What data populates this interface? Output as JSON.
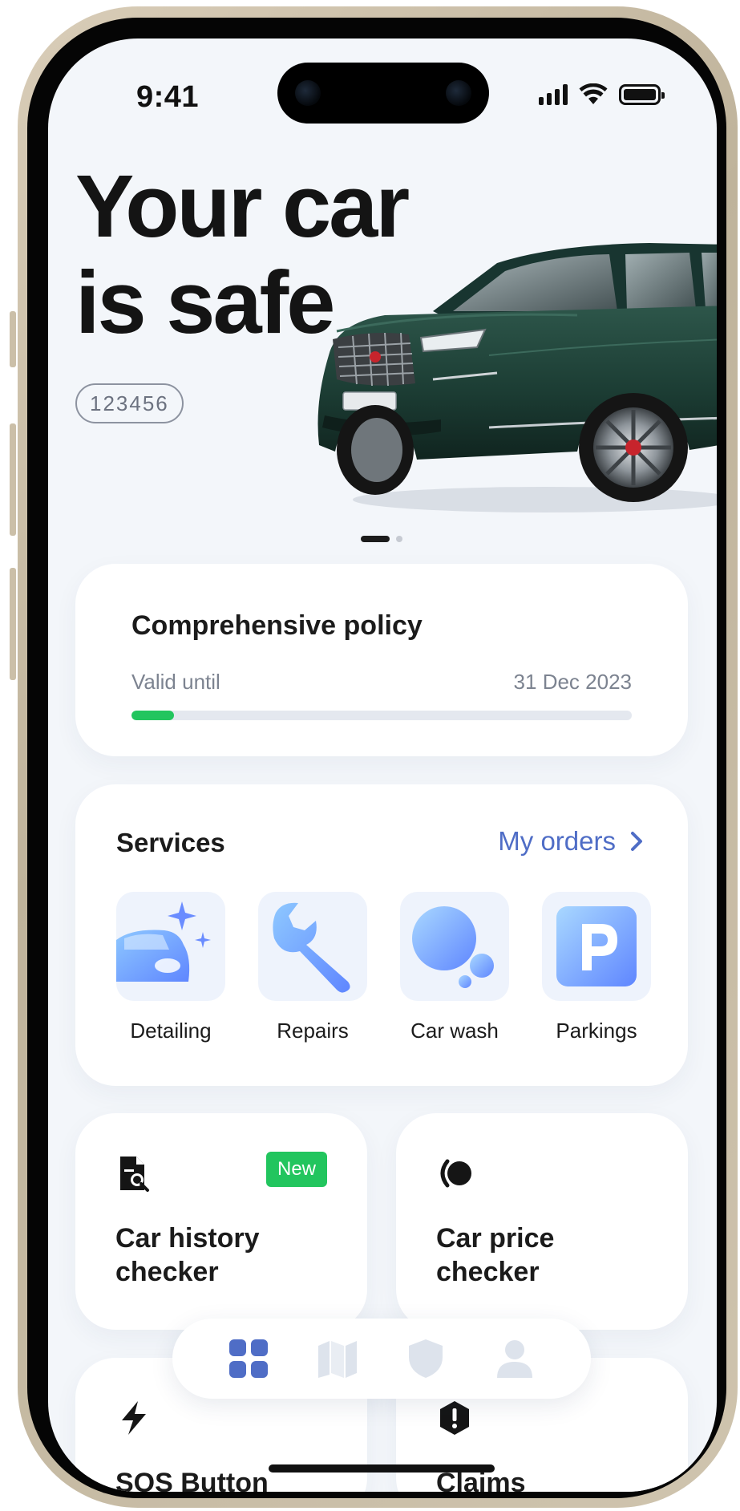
{
  "status_bar": {
    "time": "9:41"
  },
  "hero": {
    "title_line1": "Your car",
    "title_line2": "is safe",
    "plate": "123456",
    "carousel_pages": 2,
    "carousel_active": 1
  },
  "policy": {
    "title": "Comprehensive policy",
    "valid_label": "Valid until",
    "valid_date": "31 Dec 2023",
    "progress": 0.085
  },
  "services": {
    "title": "Services",
    "orders_link": "My orders",
    "items": [
      {
        "label": "Detailing",
        "icon": "car-sparkle-icon"
      },
      {
        "label": "Repairs",
        "icon": "wrench-icon"
      },
      {
        "label": "Car wash",
        "icon": "bubbles-icon"
      },
      {
        "label": "Parkings",
        "icon": "parking-icon"
      }
    ]
  },
  "features": [
    {
      "title": "Car history checker",
      "icon": "document-search-icon",
      "badge": "New"
    },
    {
      "title": "Car price checker",
      "icon": "coin-icon"
    },
    {
      "title": "SOS Button",
      "icon": "lightning-icon"
    },
    {
      "title": "Claims",
      "icon": "alert-icon"
    }
  ],
  "tabbar": {
    "items": [
      {
        "name": "home",
        "icon": "grid-icon",
        "active": true
      },
      {
        "name": "map",
        "icon": "map-icon",
        "active": false
      },
      {
        "name": "insurance",
        "icon": "shield-icon",
        "active": false
      },
      {
        "name": "profile",
        "icon": "user-icon",
        "active": false
      }
    ]
  },
  "colors": {
    "accent": "#4f6dc6",
    "success": "#22c55e",
    "background": "#f3f6fa",
    "car_body": "#1d3f36"
  }
}
